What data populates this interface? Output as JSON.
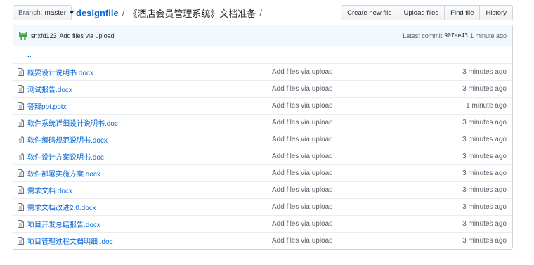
{
  "branch": {
    "label": "Branch:",
    "value": "master"
  },
  "breadcrumb": {
    "root": "designfile",
    "separator": "/",
    "dir": "《酒店会员管理系统》文档准备",
    "trailing": "/"
  },
  "actions": [
    "Create new file",
    "Upload files",
    "Find file",
    "History"
  ],
  "commit": {
    "author": "snxfd123",
    "message": "Add files via upload",
    "latest_label": "Latest commit",
    "sha": "907ee43",
    "age": "1 minute ago"
  },
  "parent_link": "..",
  "files": [
    {
      "name": "概要设计说明书.docx",
      "message": "Add files via upload",
      "age": "3 minutes ago"
    },
    {
      "name": "测试报告.docx",
      "message": "Add files via upload",
      "age": "3 minutes ago"
    },
    {
      "name": "答辩ppt.pptx",
      "message": "Add files via upload",
      "age": "1 minute ago"
    },
    {
      "name": "软件系统详细设计说明书.doc",
      "message": "Add files via upload",
      "age": "3 minutes ago"
    },
    {
      "name": "软件编码规范说明书.docx",
      "message": "Add files via upload",
      "age": "3 minutes ago"
    },
    {
      "name": "软件设计方案说明书.doc",
      "message": "Add files via upload",
      "age": "3 minutes ago"
    },
    {
      "name": "软件部署实施方案.docx",
      "message": "Add files via upload",
      "age": "3 minutes ago"
    },
    {
      "name": "需求文档.docx",
      "message": "Add files via upload",
      "age": "3 minutes ago"
    },
    {
      "name": "需求文档改进2.0.docx",
      "message": "Add files via upload",
      "age": "3 minutes ago"
    },
    {
      "name": "项目开发总结报告.docx",
      "message": "Add files via upload",
      "age": "3 minutes ago"
    },
    {
      "name": "项目管理过程文档明细 .doc",
      "message": "Add files via upload",
      "age": "3 minutes ago"
    }
  ],
  "icons": {
    "file": "file-icon",
    "avatar": "identicon-avatar",
    "caret": "caret-down-icon"
  },
  "colors": {
    "link": "#0366d6",
    "muted": "#586069",
    "commit_bg": "#f1f8ff"
  }
}
